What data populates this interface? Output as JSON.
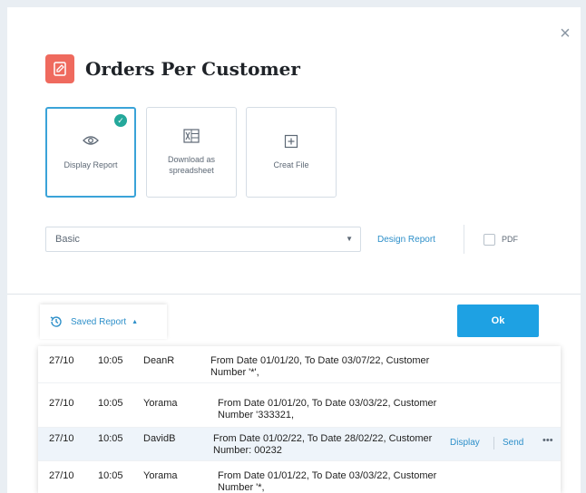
{
  "dialog": {
    "title": "Orders Per Customer",
    "close_icon": "×",
    "options": [
      {
        "icon": "eye-icon",
        "label": "Display Report",
        "selected": true
      },
      {
        "icon": "spreadsheet-icon",
        "label": "Download as spreadsheet",
        "selected": false
      },
      {
        "icon": "plus-icon",
        "label": "Creat File",
        "selected": false
      }
    ],
    "template_select": {
      "value": "Basic"
    },
    "design_report_label": "Design Report",
    "pdf_label": "PDF",
    "saved_report_label": "Saved Report",
    "ok_label": "Ok"
  },
  "saved_reports": [
    {
      "date": "27/10",
      "time": "10:05",
      "user": "DeanR",
      "description": "From Date 01/01/20, To Date 03/07/22, Customer Number '*',",
      "selected": false
    },
    {
      "date": "27/10",
      "time": "10:05",
      "user": "Yorama",
      "description": "From Date 01/01/20, To Date 03/03/22, Customer Number '333321,",
      "selected": false
    },
    {
      "date": "27/10",
      "time": "10:05",
      "user": "DavidB",
      "description": "From Date 01/02/22, To Date 28/02/22, Customer Number: 00232",
      "selected": true,
      "actions": {
        "display": "Display",
        "send": "Send",
        "more": "•••"
      }
    },
    {
      "date": "27/10",
      "time": "10:05",
      "user": "Yorama",
      "description": "From Date 01/01/22, To Date 03/03/22, Customer Number '*,",
      "selected": false
    }
  ],
  "colors": {
    "accent": "#1ea1e3",
    "brand_icon": "#ef6a5e",
    "check": "#24a89b",
    "link": "#2d8fc9"
  }
}
